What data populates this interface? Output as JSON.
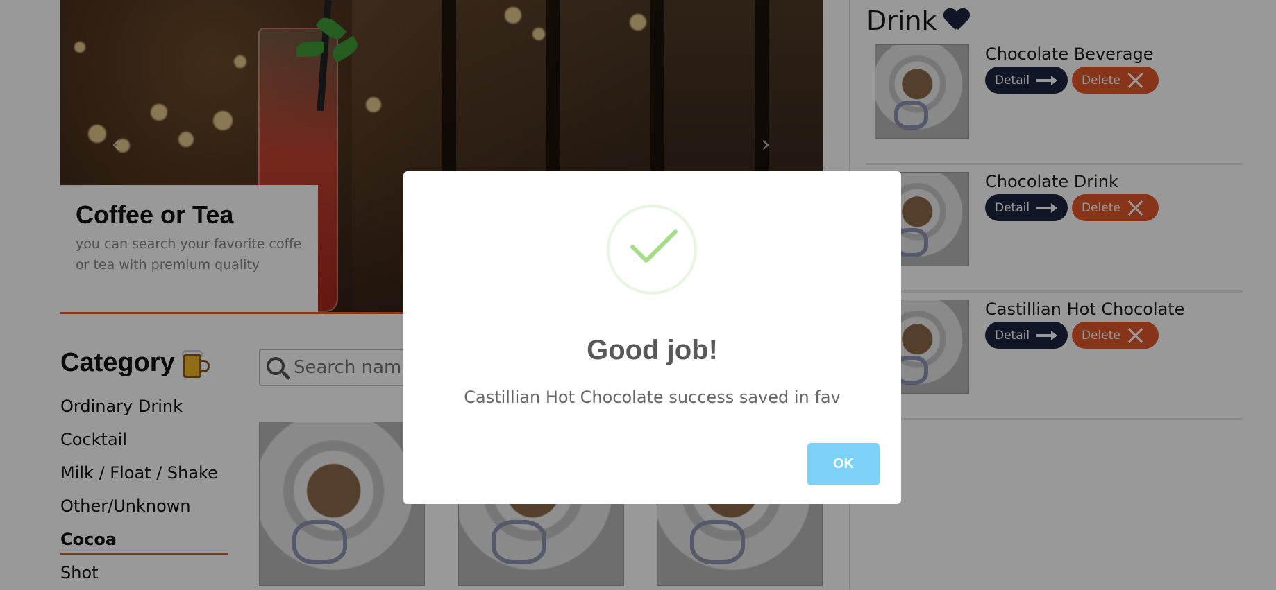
{
  "carousel": {
    "caption_title": "Coffee or Tea",
    "caption_text": "you can search  your favorite coffe or tea with premium quality",
    "prev_glyph": "‹",
    "next_glyph": "›"
  },
  "category": {
    "title": "Category",
    "icon": "beer-mug-icon",
    "items": [
      {
        "label": "Ordinary Drink"
      },
      {
        "label": "Cocktail"
      },
      {
        "label": "Milk / Float / Shake"
      },
      {
        "label": "Other/Unknown"
      },
      {
        "label": "Cocoa"
      },
      {
        "label": "Shot"
      }
    ],
    "active": "Cocoa"
  },
  "search": {
    "placeholder": "Search name"
  },
  "favorites": {
    "title": "Drink",
    "icon": "heart-icon",
    "items": [
      {
        "name": "Chocolate Beverage",
        "detail_label": "Detail",
        "delete_label": "Delete"
      },
      {
        "name": "Chocolate Drink",
        "detail_label": "Detail",
        "delete_label": "Delete"
      },
      {
        "name": "Castillian Hot Chocolate",
        "detail_label": "Detail",
        "delete_label": "Delete"
      }
    ]
  },
  "modal": {
    "icon": "success-check-icon",
    "title": "Good job!",
    "message": "Castillian Hot Chocolate success saved in fav",
    "ok_label": "OK"
  },
  "colors": {
    "accent": "#e2572a",
    "navy": "#1d2540",
    "ok_button": "#7cd1f9",
    "success": "#a5dc86"
  }
}
